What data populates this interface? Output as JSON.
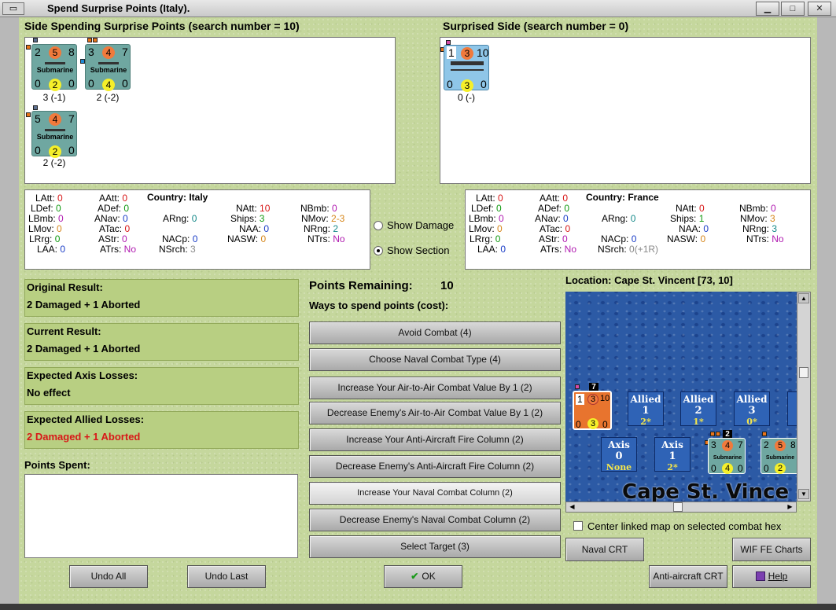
{
  "window": {
    "title": "Spend Surprise Points (Italy).",
    "system_button": "▭",
    "minimize": "▁",
    "maximize": "□",
    "close": "✕"
  },
  "spending_side": {
    "header": "Side Spending Surprise Points (search number = 10)",
    "units": [
      {
        "att": "2",
        "mid": "5",
        "rng": "8",
        "type": "Submarine",
        "l": "0",
        "m": "2",
        "r": "0",
        "caption": "3 (-1)"
      },
      {
        "att": "3",
        "mid": "4",
        "rng": "7",
        "type": "Submarine",
        "l": "0",
        "m": "4",
        "r": "0",
        "caption": "2 (-2)"
      },
      {
        "att": "5",
        "mid": "4",
        "rng": "7",
        "type": "Submarine",
        "l": "0",
        "m": "2",
        "r": "0",
        "caption": "2 (-2)"
      }
    ]
  },
  "surprised_side": {
    "header": "Surprised Side (search number = 0)",
    "units": [
      {
        "att": "1",
        "mid": "3",
        "rng": "10",
        "l": "0",
        "m": "3",
        "r": "0",
        "caption": "0 (-)"
      }
    ]
  },
  "stats_left": {
    "country_label": "Country:",
    "country": "Italy",
    "latt": "0",
    "ldef": "0",
    "lbmb": "0",
    "lmov": "0",
    "lrrg": "0",
    "laa": "0",
    "aatt": "0",
    "adef": "0",
    "anav": "0",
    "atac": "0",
    "astr": "0",
    "atrs": "No",
    "arng": "0",
    "nacp": "0",
    "nsrch": "3",
    "natt": "10",
    "ships": "3",
    "naa": "0",
    "nasw": "0",
    "nbmb": "0",
    "nmov": "2-3",
    "nrng": "2",
    "ntrs": "No"
  },
  "stats_right": {
    "country_label": "Country:",
    "country": "France",
    "latt": "0",
    "ldef": "0",
    "lbmb": "0",
    "lmov": "0",
    "lrrg": "0",
    "laa": "0",
    "aatt": "0",
    "adef": "0",
    "anav": "0",
    "atac": "0",
    "astr": "0",
    "atrs": "No",
    "arng": "0",
    "nacp": "0",
    "nsrch": "0(+1R)",
    "natt": "0",
    "ships": "1",
    "naa": "0",
    "nasw": "0",
    "nbmb": "0",
    "nmov": "3",
    "nrng": "3",
    "ntrs": "No"
  },
  "stat_labels": {
    "latt": "LAtt:",
    "ldef": "LDef:",
    "lbmb": "LBmb:",
    "lmov": "LMov:",
    "lrrg": "LRrg:",
    "laa": "LAA:",
    "aatt": "AAtt:",
    "adef": "ADef:",
    "anav": "ANav:",
    "atac": "ATac:",
    "astr": "AStr:",
    "atrs": "ATrs:",
    "arng": "ARng:",
    "nacp": "NACp:",
    "nsrch": "NSrch:",
    "natt": "NAtt:",
    "ships": "Ships:",
    "naa": "NAA:",
    "nasw": "NASW:",
    "nbmb": "NBmb:",
    "nmov": "NMov:",
    "nrng": "NRng:",
    "ntrs": "NTrs:"
  },
  "options": {
    "show_damage": "Show Damage",
    "show_section": "Show Section"
  },
  "results": {
    "original_label": "Original Result:",
    "original_value": "2 Damaged + 1 Aborted",
    "current_label": "Current Result:",
    "current_value": "2 Damaged + 1 Aborted",
    "axis_label": "Expected Axis Losses:",
    "axis_value": "No effect",
    "allied_label": "Expected Allied Losses:",
    "allied_value": "2 Damaged + 1 Aborted",
    "points_spent_label": "Points Spent:"
  },
  "points": {
    "remaining_label": "Points Remaining:",
    "remaining_value": "10",
    "ways_label": "Ways to spend points (cost):",
    "actions": [
      "Avoid Combat (4)",
      "Choose Naval Combat Type (4)",
      "Increase Your Air-to-Air Combat Value By 1 (2)",
      "Decrease Enemy's Air-to-Air Combat Value By 1 (2)",
      "Increase Your Anti-Aircraft Fire Column (2)",
      "Decrease Enemy's Anti-Aircraft Fire Column (2)",
      "Increase Your Naval Combat Column (2)",
      "Decrease Enemy's Naval Combat Column (2)",
      "Select Target (3)"
    ]
  },
  "map": {
    "location_label": "Location: Cape St. Vincent [73, 10]",
    "boxes": [
      {
        "side": "Allied",
        "num": "1",
        "val": "2*"
      },
      {
        "side": "Allied",
        "num": "2",
        "val": "1*"
      },
      {
        "side": "Allied",
        "num": "3",
        "val": "0*"
      },
      {
        "side": "Axis",
        "num": "0",
        "val": "None"
      },
      {
        "side": "Axis",
        "num": "1",
        "val": "2*"
      }
    ],
    "stack_count_a": "7",
    "stack_count_b": "2",
    "map_label": "Cape St. Vince",
    "center_linked": "Center linked map on selected combat hex"
  },
  "buttons": {
    "undo_all": "Undo All",
    "undo_last": "Undo Last",
    "ok": "OK",
    "naval_crt": "Naval CRT",
    "wif_fe_charts": "WIF FE Charts",
    "anti_aircraft_crt": "Anti-aircraft CRT",
    "help": "Help"
  },
  "colors": {
    "allied_losses": "#d81818",
    "panel_green": "#b8cf82",
    "sea_blue": "#2c5aa5"
  }
}
